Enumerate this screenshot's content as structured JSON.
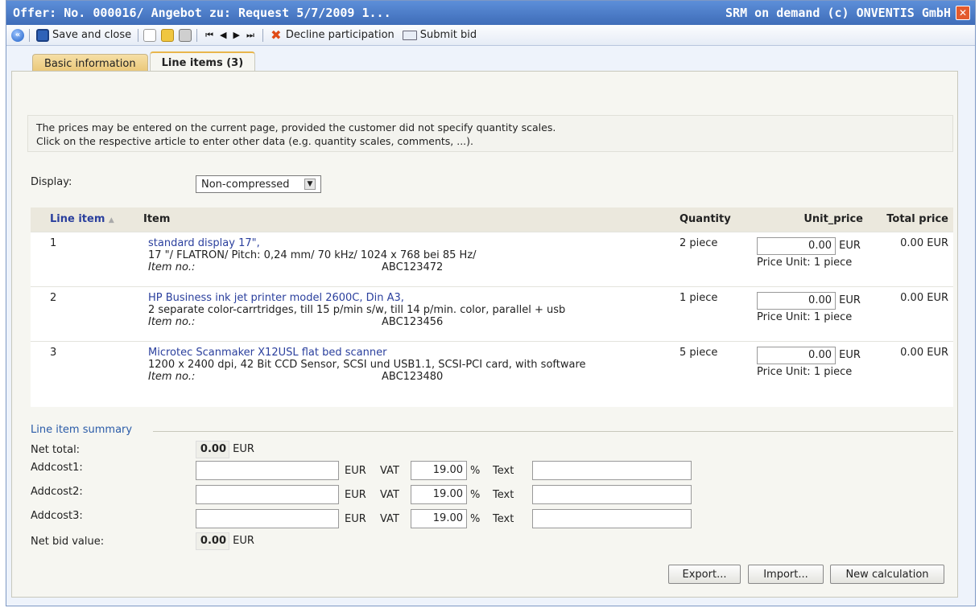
{
  "window": {
    "title": "Offer: No. 000016/ Angebot zu: Request 5/7/2009 1...",
    "brand": "SRM on demand (c) ONVENTIS GmbH",
    "close_glyph": "✕"
  },
  "toolbar": {
    "save_close": "Save and close",
    "decline": "Decline participation",
    "submit": "Submit bid",
    "nav": [
      "⏮",
      "◀",
      "▶",
      "⏭"
    ]
  },
  "tabs": {
    "basic": "Basic information",
    "line_items": "Line items (3)"
  },
  "info": {
    "line1": "The prices may be entered on the current page, provided the customer did not specify quantity scales.",
    "line2": "Click on the respective article to enter other data (e.g. quantity scales, comments, ...)."
  },
  "display": {
    "label": "Display:",
    "value": "Non-compressed"
  },
  "table": {
    "headers": {
      "line_item": "Line item",
      "sort_glyph": "▲",
      "item": "Item",
      "quantity": "Quantity",
      "unit_price": "Unit_price",
      "total_price": "Total price"
    },
    "rows": [
      {
        "no": "1",
        "title": "standard display 17\",",
        "desc": "17 \"/ FLATRON/ Pitch: 0,24 mm/ 70 kHz/ 1024 x 768 bei 85 Hz/",
        "item_no_label": "Item no.:",
        "item_no": "ABC123472",
        "qty": "2 piece",
        "price": "0.00",
        "currency": "EUR",
        "price_unit": "Price Unit: 1 piece",
        "total": "0.00 EUR"
      },
      {
        "no": "2",
        "title": "HP Business ink jet printer model 2600C, Din A3,",
        "desc": "2 separate color-carrtridges, till 15 p/min s/w, till 14 p/min. color, parallel + usb",
        "item_no_label": "Item no.:",
        "item_no": "ABC123456",
        "qty": "1 piece",
        "price": "0.00",
        "currency": "EUR",
        "price_unit": "Price Unit: 1 piece",
        "total": "0.00 EUR"
      },
      {
        "no": "3",
        "title": "Microtec Scanmaker X12USL flat bed scanner",
        "desc": "1200 x 2400 dpi, 42 Bit CCD Sensor, SCSI und USB1.1, SCSI-PCI card, with software",
        "item_no_label": "Item no.:",
        "item_no": "ABC123480",
        "qty": "5 piece",
        "price": "0.00",
        "currency": "EUR",
        "price_unit": "Price Unit: 1 piece",
        "total": "0.00 EUR"
      }
    ]
  },
  "summary": {
    "legend": "Line item summary",
    "net_total_label": "Net total:",
    "net_total": "0.00",
    "currency": "EUR",
    "vat_label": "VAT",
    "percent": "%",
    "text_label": "Text",
    "addcosts": [
      {
        "label": "Addcost1:",
        "vat": "19.00"
      },
      {
        "label": "Addcost2:",
        "vat": "19.00"
      },
      {
        "label": "Addcost3:",
        "vat": "19.00"
      }
    ],
    "net_bid_label": "Net bid value:",
    "net_bid": "0.00"
  },
  "buttons": {
    "export": "Export...",
    "import": "Import...",
    "new_calc": "New calculation"
  }
}
